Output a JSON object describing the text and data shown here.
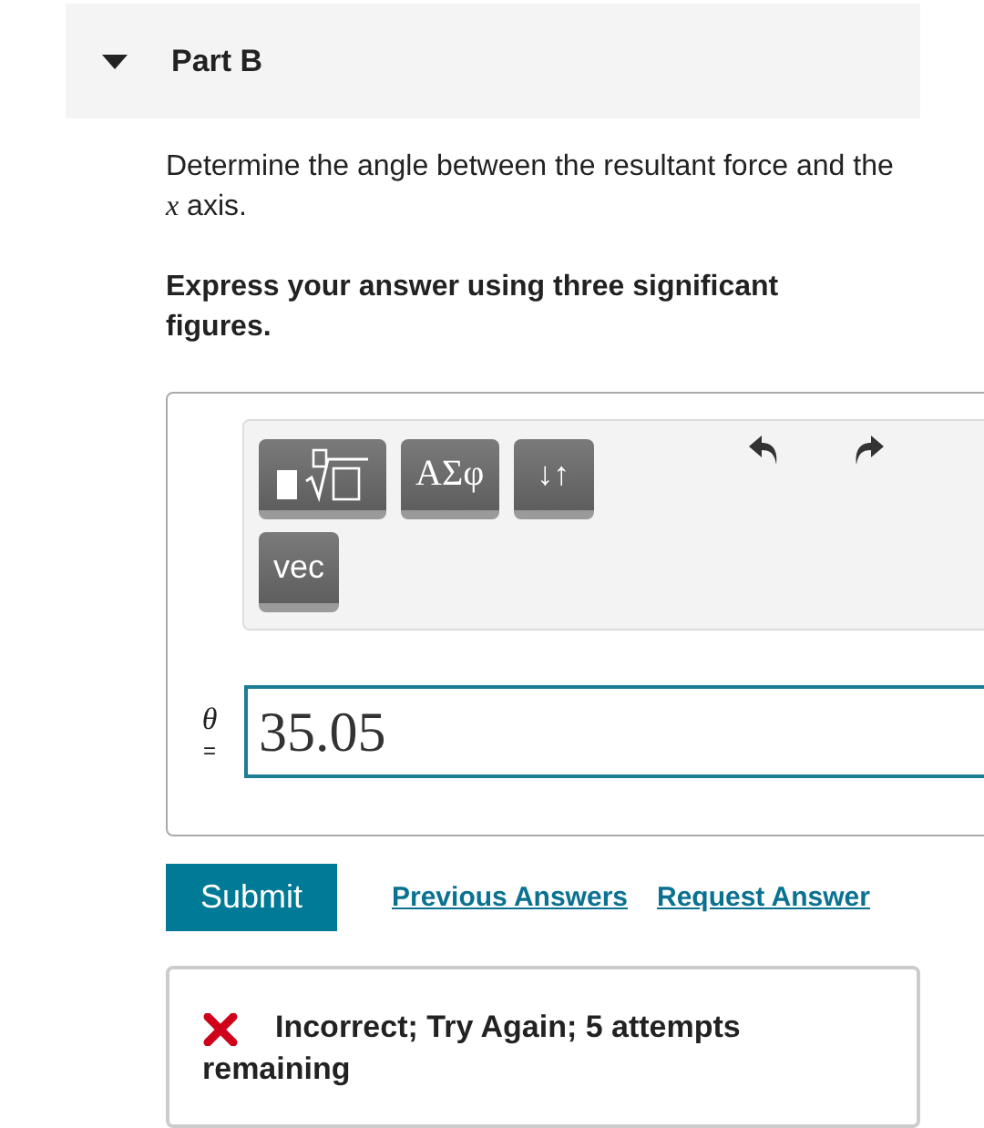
{
  "part": {
    "title": "Part B",
    "expanded": true
  },
  "question": "Determine the angle between the resultant force and the *x* axis.",
  "instruction": "Express your answer using three significant figures.",
  "toolbar": {
    "rows": [
      [
        {
          "kind": "template"
        },
        {
          "kind": "greek",
          "label": "ΑΣφ"
        },
        {
          "kind": "text",
          "label": "↓↑"
        }
      ],
      [
        {
          "kind": "text",
          "label": "vec"
        }
      ]
    ]
  },
  "answer": {
    "variable": "θ",
    "equals": "=",
    "value": "35.05"
  },
  "actions": {
    "submit": "Submit",
    "links": [
      "Previous Answers",
      "Request Answer"
    ]
  },
  "feedback": {
    "correct": false,
    "lines": [
      "Incorrect; Try Again; 5 attempts",
      "remaining"
    ]
  }
}
